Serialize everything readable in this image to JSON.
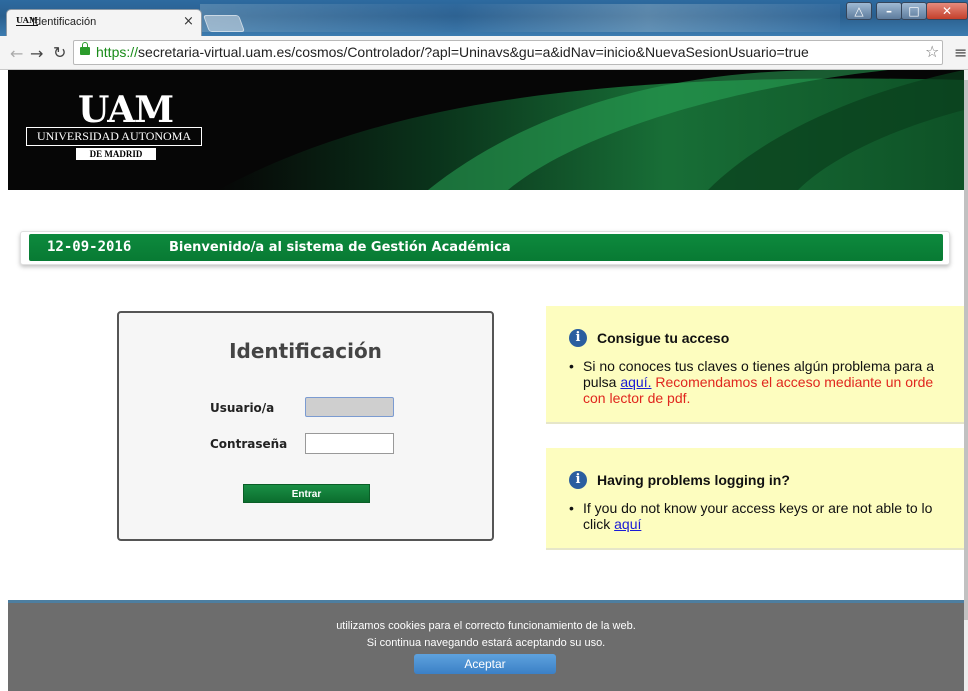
{
  "browser": {
    "tab_title": "Identificación",
    "tab_favicon": "UAM",
    "tab_close": "×",
    "url_scheme": "https://",
    "url_rest": "secretaria-virtual.uam.es/cosmos/Controlador/?apl=Uninavs&gu=a&idNav=inicio&NuevaSesionUsuario=true",
    "icons": [
      "back-icon",
      "forward-icon",
      "reload-icon",
      "lock-icon",
      "star-icon",
      "menu-icon"
    ]
  },
  "header": {
    "logo_mark": "UAM",
    "logo_name": "UNIVERSIDAD AUTONOMA",
    "logo_city": "DE MADRID"
  },
  "welcome": {
    "date": "12-09-2016",
    "message": "Bienvenido/a al sistema de Gestión Académica"
  },
  "login": {
    "title": "Identificación",
    "user_label": "Usuario/a",
    "password_label": "Contraseña",
    "user_value": "",
    "password_value": "",
    "submit_label": "Entrar"
  },
  "info_es": {
    "heading": "Consigue tu acceso",
    "line1": "Si no conoces tus claves o tienes algún problema para a",
    "line2_pre": "pulsa ",
    "line2_link": "aquí.",
    "line2_red": " Recomendamos el acceso mediante un orde",
    "line3_red": "con lector de pdf."
  },
  "info_en": {
    "heading": "Having problems logging in?",
    "line1": "If you do not know your access keys or are not able to lo",
    "line2_pre": "click ",
    "line2_link": "aquí"
  },
  "cookie": {
    "line1": "utilizamos cookies para el correcto funcionamiento de la web.",
    "line2": "Si continua navegando estará aceptando su uso.",
    "accept_label": "Aceptar"
  },
  "colors": {
    "brand_green": "#0d8a3e",
    "info_yellow": "#fdfdbf",
    "link_blue": "#1a1ad6",
    "warning_red": "#e0261e",
    "accept_blue": "#4a8fd2"
  }
}
